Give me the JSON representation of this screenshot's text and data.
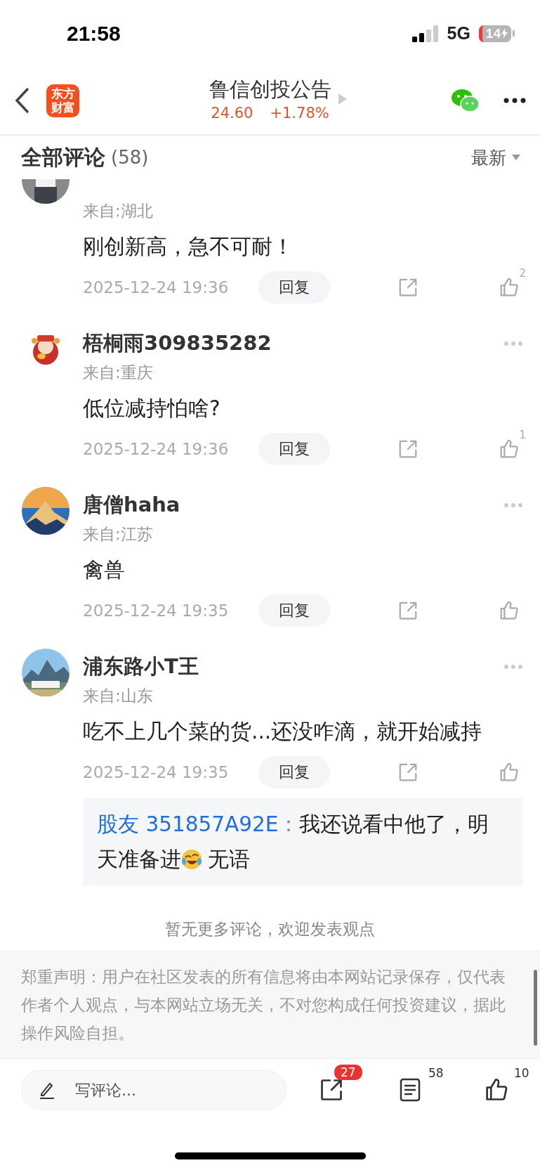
{
  "status_bar": {
    "time": "21:58",
    "network": "5G",
    "battery": "14"
  },
  "header": {
    "logo_lines": [
      "东方",
      "财富"
    ],
    "title": "鲁信创投公告",
    "price": "24.60",
    "change": "+1.78%"
  },
  "comments_header": {
    "title": "全部评论",
    "count": "(58)",
    "sort": "最新"
  },
  "comments": [
    {
      "partial": true,
      "location": "来自:湖北",
      "text": "刚创新高，急不可耐！",
      "time": "2025-12-24 19:36",
      "reply_label": "回复",
      "likes": "2"
    },
    {
      "partial": false,
      "name": "梧桐雨309835282",
      "location": "来自:重庆",
      "text": "低位减持怕啥?",
      "time": "2025-12-24 19:36",
      "reply_label": "回复",
      "likes": "1"
    },
    {
      "partial": false,
      "name": "唐僧haha",
      "location": "来自:江苏",
      "text": "禽兽",
      "time": "2025-12-24 19:35",
      "reply_label": "回复"
    },
    {
      "partial": false,
      "name": "浦东路小T王",
      "location": "来自:山东",
      "text": "吃不上几个菜的货...还没咋滴，就开始减持",
      "time": "2025-12-24 19:35",
      "reply_label": "回复",
      "reply": {
        "author": "股友 351857A92E",
        "separator": "：",
        "text_before": "我还说看中他了，明天准备进",
        "text_after": "无语"
      }
    }
  ],
  "end_note": "暂无更多评论，欢迎发表观点",
  "disclaimer": "郑重声明：用户在社区发表的所有信息将由本网站记录保存，仅代表作者个人观点，与本网站立场无关，不对您构成任何投资建议，据此操作风险自担。",
  "bottom_bar": {
    "placeholder": "写评论...",
    "share_badge": "27",
    "comment_count": "58",
    "like_count": "10"
  }
}
